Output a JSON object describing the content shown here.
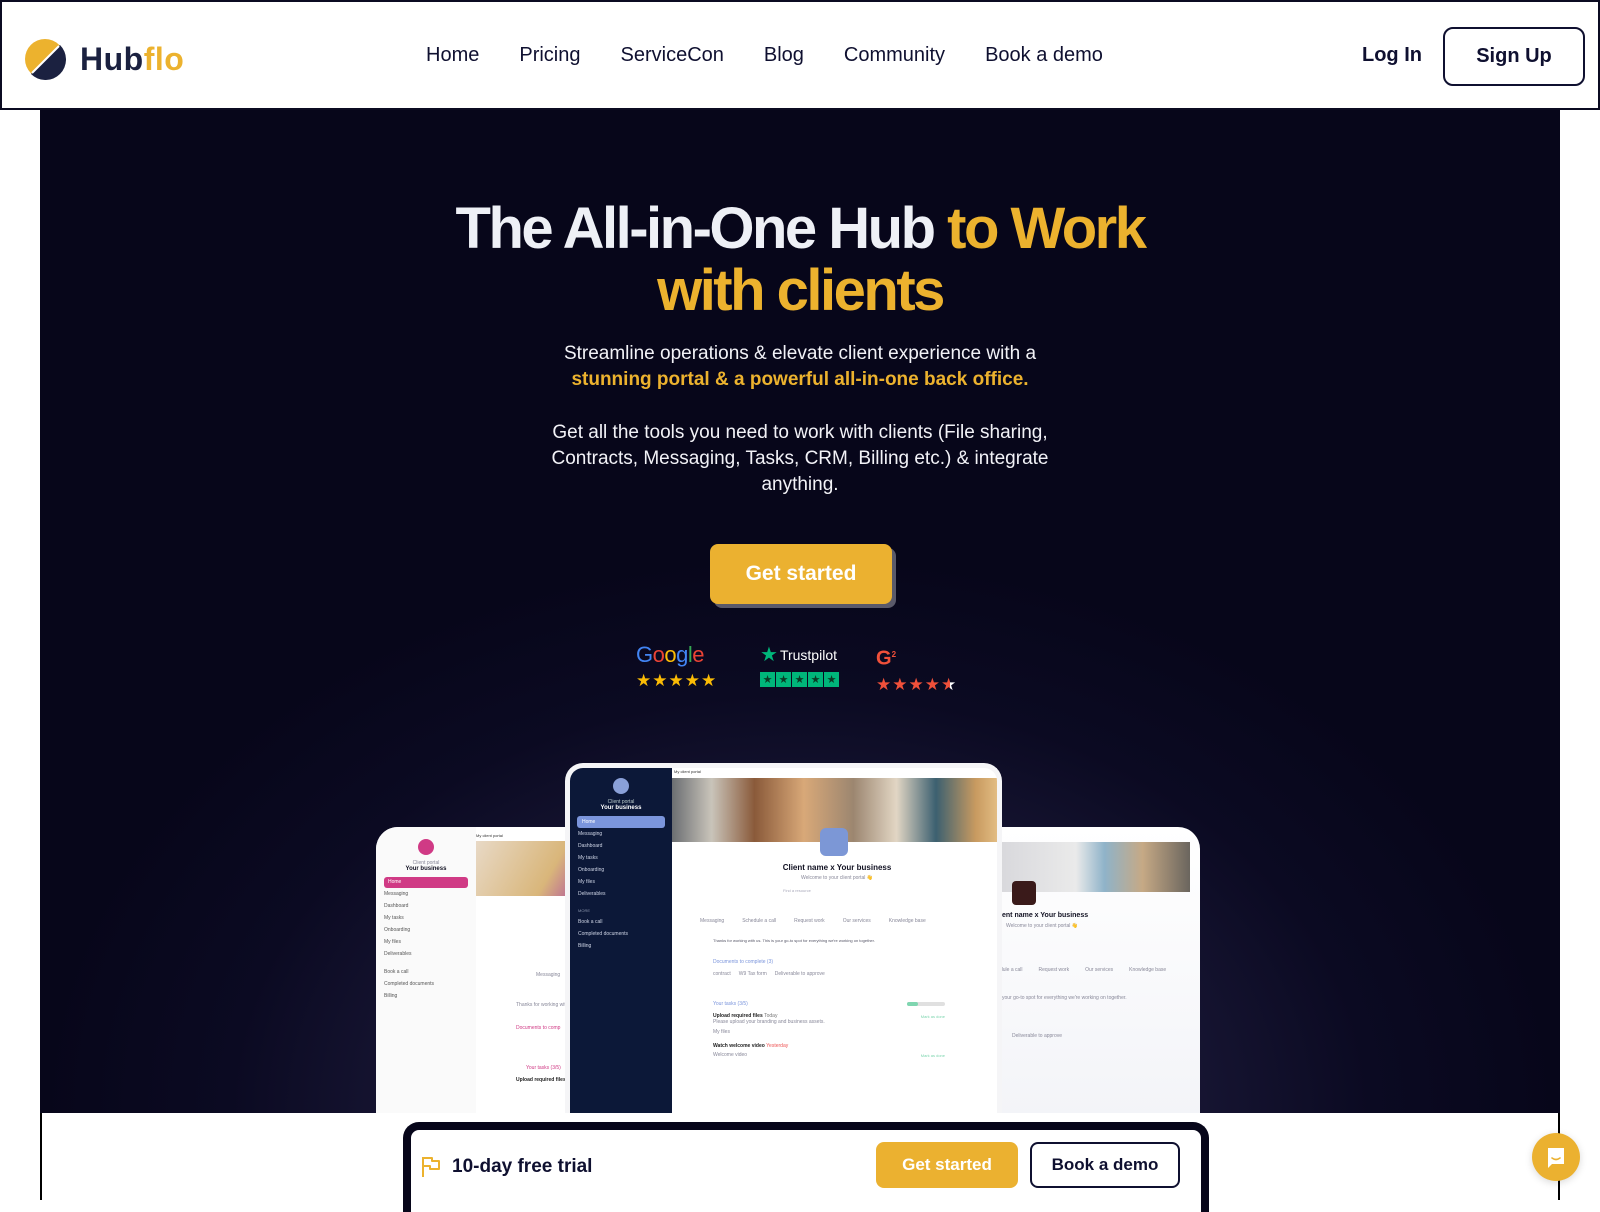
{
  "brand": {
    "name_part1": "Hub",
    "name_part2": "flo",
    "colors": {
      "yellow": "#ecb22e",
      "navy": "#1b2140"
    }
  },
  "nav": {
    "items": [
      {
        "label": "Home"
      },
      {
        "label": "Pricing"
      },
      {
        "label": "ServiceCon"
      },
      {
        "label": "Blog"
      },
      {
        "label": "Community"
      },
      {
        "label": "Book a demo"
      }
    ],
    "login_label": "Log In",
    "signup_label": "Sign Up"
  },
  "hero": {
    "title_white": "The All-in-One Hub ",
    "title_yellow_1": "to Work",
    "title_yellow_2": "with clients",
    "subtitle_plain": "Streamline operations & elevate client experience with a",
    "subtitle_highlight": "stunning portal & a powerful all-in-one back office.",
    "description": "Get all the tools you need to work with clients (File sharing, Contracts, Messaging, Tasks, CRM, Billing etc.) & integrate anything.",
    "cta_label": "Get started"
  },
  "ratings": [
    {
      "source": "Google",
      "stars": 5,
      "icon": "google-logo"
    },
    {
      "source": "Trustpilot",
      "stars": 5,
      "icon": "trustpilot-star"
    },
    {
      "source": "G2",
      "stars": 4.5,
      "icon": "g2-logo"
    }
  ],
  "mockups": {
    "center": {
      "topbar": "My client portal",
      "portal_label": "Client portal",
      "business": "Your business",
      "sidebar": [
        "Home",
        "Messaging",
        "Dashboard",
        "My tasks",
        "Onboarding",
        "My files",
        "Deliverables"
      ],
      "more_label": "MORE",
      "more_items": [
        "Book a call",
        "Completed documents",
        "Billing"
      ],
      "heading": "Client name x Your business",
      "welcome": "Welcome to your client portal 👋",
      "search_placeholder": "Find a resource",
      "actions": [
        "Messaging",
        "Schedule a call",
        "Request work",
        "Our services",
        "Knowledge base"
      ],
      "intro": "Thanks for working with us. This is your go-to spot for everything we're working on together.",
      "documents_title": "Documents to complete (3)",
      "documents": [
        "contract",
        "W9 Tax form",
        "Deliverable to approve"
      ],
      "tasks_title": "Your tasks (3/5)",
      "tasks": [
        {
          "title": "Upload required files",
          "due": "Today",
          "desc": "Please upload your branding and business assets.",
          "file": "My files",
          "action": "Mark as done"
        },
        {
          "title": "Watch welcome video",
          "due": "Yesterday",
          "file": "Welcome video",
          "action": "Mark as done"
        }
      ]
    },
    "left": {
      "topbar": "My client portal",
      "portal_label": "Client portal",
      "business": "Your business",
      "sidebar": [
        "Home",
        "Messaging",
        "Dashboard",
        "My tasks",
        "Onboarding",
        "My files",
        "Deliverables"
      ],
      "more_items": [
        "Book a call",
        "Completed documents",
        "Billing"
      ],
      "action": "Messaging",
      "intro": "Thanks for working with us",
      "documents_title": "Documents to comp",
      "tasks_title": "Your tasks (3/5)",
      "task": "Upload required files"
    },
    "right": {
      "heading": "ent name x Your business",
      "welcome": "Welcome to your client portal 👋",
      "actions": [
        "dule a call",
        "Request work",
        "Our services",
        "Knowledge base"
      ],
      "intro": "your go-to spot for everything we're working on together.",
      "document": "Deliverable to approve"
    }
  },
  "bottom_bar": {
    "trial_label": "10-day free trial",
    "get_started_label": "Get started",
    "book_demo_label": "Book a demo"
  }
}
